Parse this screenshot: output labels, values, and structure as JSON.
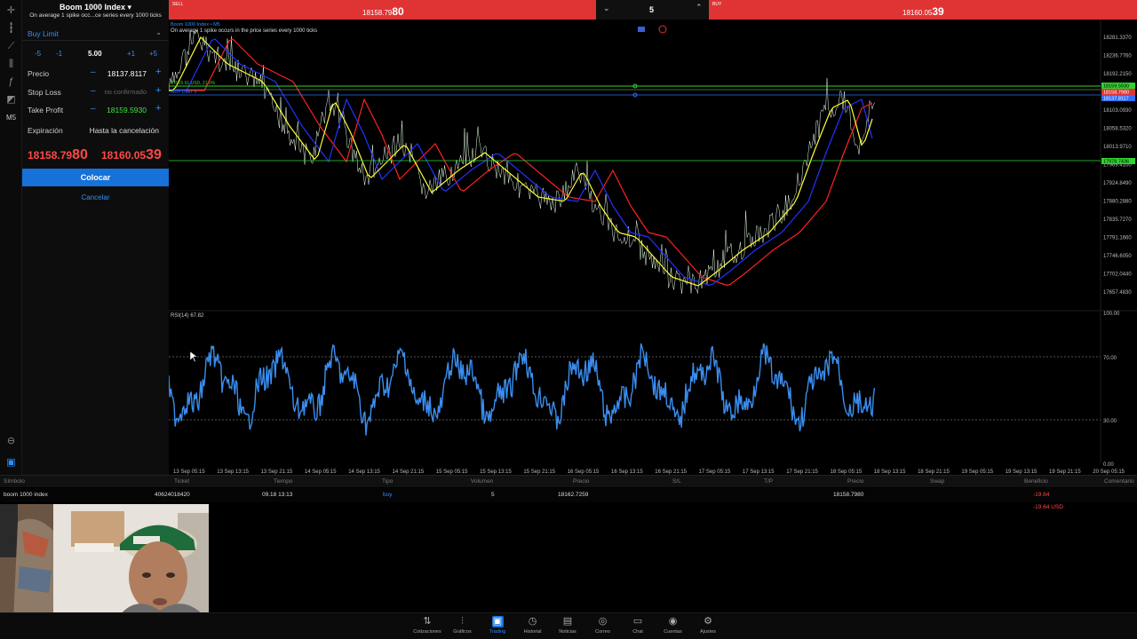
{
  "panel": {
    "symbol_title": "Boom 1000 Index",
    "symbol_subtitle": "On average 1 spike occ...ce series every 1000 ticks",
    "order_type": "Buy Limit",
    "volume": {
      "m5": "-5",
      "m1": "-1",
      "value": "5.00",
      "p1": "+1",
      "p5": "+5"
    },
    "price": {
      "label": "Precio",
      "value": "18137.8117"
    },
    "stop_loss": {
      "label": "Stop Loss",
      "value": "no confirmado"
    },
    "take_profit": {
      "label": "Take Profit",
      "value": "18159.5930"
    },
    "expiration": {
      "label": "Expiración",
      "value": "Hasta la cancelación"
    },
    "bid": {
      "main": "18158.79",
      "big": "80"
    },
    "ask": {
      "main": "18160.05",
      "big": "39"
    },
    "place_label": "Colocar",
    "cancel_label": "Cancelar"
  },
  "topbar": {
    "sell_tag": "SELL",
    "sell_main": "18158.79",
    "sell_big": "80",
    "volume": "5",
    "buy_tag": "BUY",
    "buy_main": "18160.05",
    "buy_big": "39"
  },
  "chart": {
    "title": "Boom 1000 Index • M5",
    "subtitle": "On average 1 spike occurs in the price series every 1000 ticks",
    "line_label_tp": "TP 15.91 USD, 21.0%",
    "line_label_limit": "BUY LIMIT 5",
    "price_ticks": [
      "18281.3370",
      "18236.7760",
      "18192.2150",
      "18147.6540",
      "18103.0930",
      "18058.5320",
      "18013.9710",
      "17969.4100",
      "17924.8490",
      "17880.2880",
      "17835.7270",
      "17791.1660",
      "17746.6050",
      "17702.0440",
      "17657.4830"
    ],
    "tag_tp": "18159.5930",
    "tag_bid": "18158.7980",
    "tag_limit": "18137.8117",
    "tag_low": "17978.7436",
    "rsi_label": "RSI(14) 67.82",
    "rsi_ticks": [
      "100.00",
      "70.00",
      "30.00",
      "0.00"
    ],
    "time_ticks": [
      "13 Sep 05:15",
      "13 Sep 13:15",
      "13 Sep 21:15",
      "14 Sep 05:15",
      "14 Sep 13:15",
      "14 Sep 21:15",
      "15 Sep 05:15",
      "15 Sep 13:15",
      "15 Sep 21:15",
      "16 Sep 05:15",
      "16 Sep 13:15",
      "16 Sep 21:15",
      "17 Sep 05:15",
      "17 Sep 13:15",
      "17 Sep 21:15",
      "18 Sep 05:15",
      "18 Sep 13:15",
      "18 Sep 21:15",
      "19 Sep 05:15",
      "19 Sep 13:15",
      "19 Sep 21:15",
      "20 Sep 05:15"
    ]
  },
  "positions": {
    "headers": [
      "Símbolo",
      "Ticket",
      "Tiempo",
      "Tipo",
      "Volumen",
      "Precio",
      "S/L",
      "T/P",
      "Precio",
      "Swap",
      "Beneficio",
      "Comentario"
    ],
    "row": [
      "boom 1000 index",
      "4062401842​0",
      "09.18 13:13",
      "buy",
      "5",
      "18162.7259",
      "",
      "",
      "18158.7980",
      "",
      "-19.64",
      ""
    ],
    "total": "-19.64  USD"
  },
  "bottom_nav": [
    "Cotizaciones",
    "Gráficos",
    "Trading",
    "Historial",
    "Noticias",
    "Correo",
    "Chat",
    "Cuentas",
    "Ajustes"
  ],
  "colors": {
    "accent": "#1671d9",
    "sell": "#e03434",
    "rsi": "#3a8ef0",
    "ma_fast": "#ffff33",
    "ma_mid": "#2233ff",
    "ma_slow": "#ff2222"
  }
}
